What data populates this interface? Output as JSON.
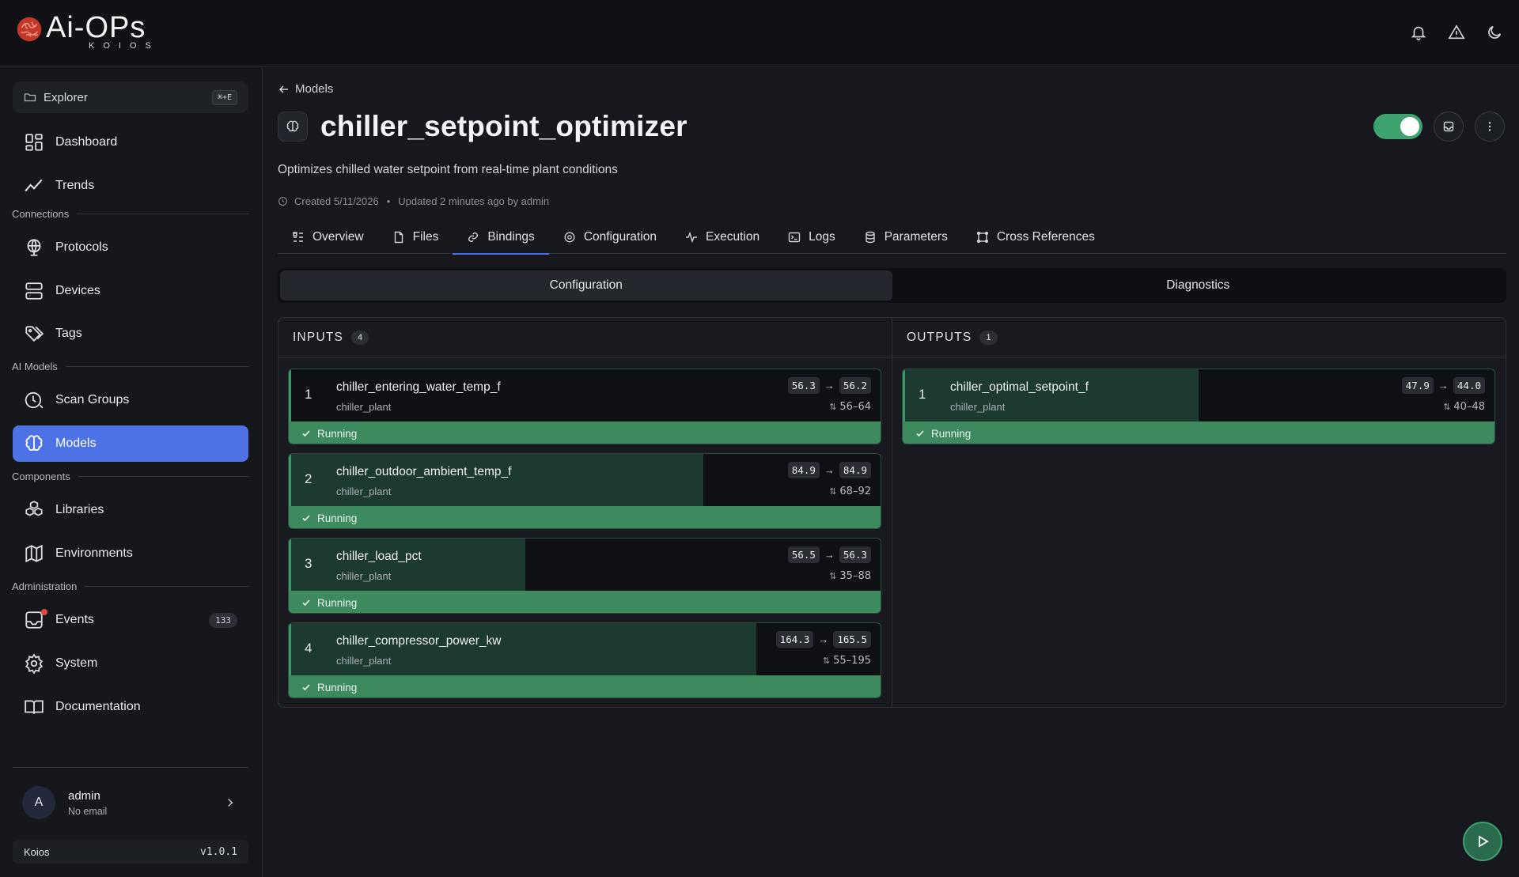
{
  "app": {
    "logo_main": "Ai-OPs",
    "logo_sub": "KOIOS"
  },
  "topbar": {
    "icons": [
      "bell-icon",
      "alert-triangle-icon",
      "moon-icon"
    ]
  },
  "sidebar": {
    "explorer": {
      "label": "Explorer",
      "shortcut": "⌘+E"
    },
    "items": [
      {
        "label": "Dashboard",
        "icon": "dashboard-icon"
      },
      {
        "label": "Trends",
        "icon": "trends-icon"
      },
      {
        "label": "Protocols",
        "icon": "globe-icon"
      },
      {
        "label": "Devices",
        "icon": "server-icon"
      },
      {
        "label": "Tags",
        "icon": "tags-icon"
      },
      {
        "label": "Scan Groups",
        "icon": "clock-icon"
      },
      {
        "label": "Models",
        "icon": "brain-icon"
      },
      {
        "label": "Libraries",
        "icon": "boxes-icon"
      },
      {
        "label": "Environments",
        "icon": "map-icon"
      },
      {
        "label": "Events",
        "icon": "inbox-icon",
        "count": "133"
      },
      {
        "label": "System",
        "icon": "gear-icon"
      },
      {
        "label": "Documentation",
        "icon": "book-icon"
      }
    ],
    "sections": {
      "connections": "Connections",
      "ai_models": "AI Models",
      "components": "Components",
      "administration": "Administration"
    },
    "user": {
      "initial": "A",
      "name": "admin",
      "email": "No email"
    },
    "footer": {
      "name": "Koios",
      "version": "v1.0.1"
    }
  },
  "main": {
    "breadcrumb": "Models",
    "title": "chiller_setpoint_optimizer",
    "description": "Optimizes chilled water setpoint from real-time plant conditions",
    "meta": {
      "created": "Created 5/11/2026",
      "separator": "•",
      "updated": "Updated 2 minutes ago by admin"
    },
    "enabled": true,
    "tabs": [
      {
        "label": "Overview",
        "icon": "overview-icon"
      },
      {
        "label": "Files",
        "icon": "file-icon"
      },
      {
        "label": "Bindings",
        "icon": "link-icon",
        "active": true
      },
      {
        "label": "Configuration",
        "icon": "gear-icon"
      },
      {
        "label": "Execution",
        "icon": "activity-icon"
      },
      {
        "label": "Logs",
        "icon": "terminal-icon"
      },
      {
        "label": "Parameters",
        "icon": "database-icon"
      },
      {
        "label": "Cross References",
        "icon": "cross-ref-icon"
      }
    ],
    "segment": {
      "left": "Configuration",
      "right": "Diagnostics",
      "active": "Configuration"
    },
    "inputs": {
      "title": "INPUTS",
      "count": "4",
      "items": [
        {
          "num": "1",
          "name": "chiller_entering_water_temp_f",
          "source": "chiller_plant",
          "from": "56.3",
          "to": "56.2",
          "range": "56–64",
          "status": "Running",
          "level": 0.0
        },
        {
          "num": "2",
          "name": "chiller_outdoor_ambient_temp_f",
          "source": "chiller_plant",
          "from": "84.9",
          "to": "84.9",
          "range": "68–92",
          "status": "Running",
          "level": 0.7
        },
        {
          "num": "3",
          "name": "chiller_load_pct",
          "source": "chiller_plant",
          "from": "56.5",
          "to": "56.3",
          "range": "35–88",
          "status": "Running",
          "level": 0.4
        },
        {
          "num": "4",
          "name": "chiller_compressor_power_kw",
          "source": "chiller_plant",
          "from": "164.3",
          "to": "165.5",
          "range": "55–195",
          "status": "Running",
          "level": 0.79
        }
      ]
    },
    "outputs": {
      "title": "OUTPUTS",
      "count": "1",
      "items": [
        {
          "num": "1",
          "name": "chiller_optimal_setpoint_f",
          "source": "chiller_plant",
          "from": "47.9",
          "to": "44.0",
          "range": "40–48",
          "status": "Running",
          "level": 0.5
        }
      ]
    }
  },
  "colors": {
    "accent": "#4c72e6",
    "running": "#3e8a5f",
    "toggle_on": "#3fa370"
  }
}
